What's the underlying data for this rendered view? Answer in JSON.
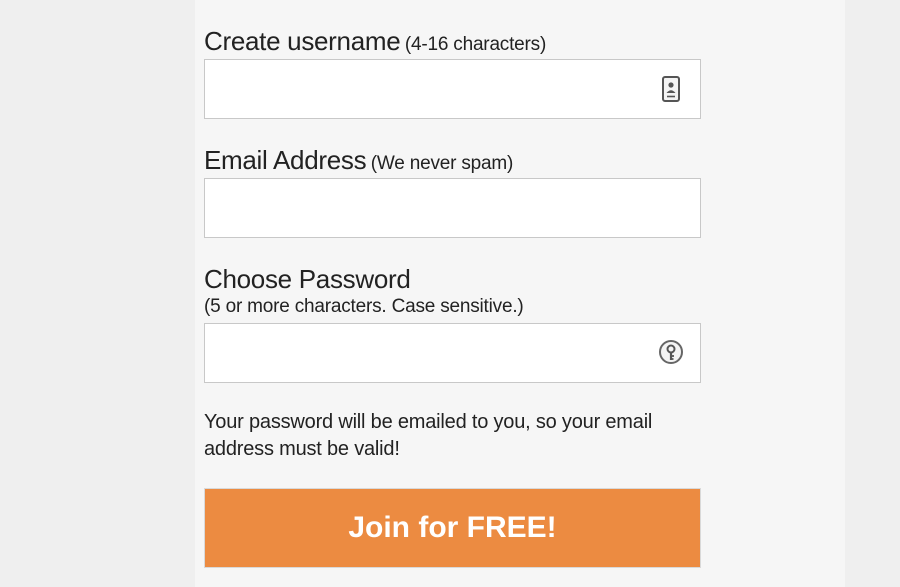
{
  "form": {
    "username": {
      "label": "Create username",
      "hint": "(4-16 characters)",
      "value": "",
      "icon": "contact-card-icon"
    },
    "email": {
      "label": "Email Address",
      "hint": "(We never spam)",
      "value": ""
    },
    "password": {
      "label": "Choose Password",
      "hint": "(5 or more characters. Case sensitive.)",
      "value": "",
      "icon": "password-key-icon"
    },
    "note": "Your password will be emailed to you, so your email address must be valid!",
    "submit_label": "Join for FREE!"
  },
  "colors": {
    "button_bg": "#ec8b41",
    "button_text": "#ffffff",
    "page_bg": "#efefef",
    "field_border": "#c8c8c8"
  }
}
